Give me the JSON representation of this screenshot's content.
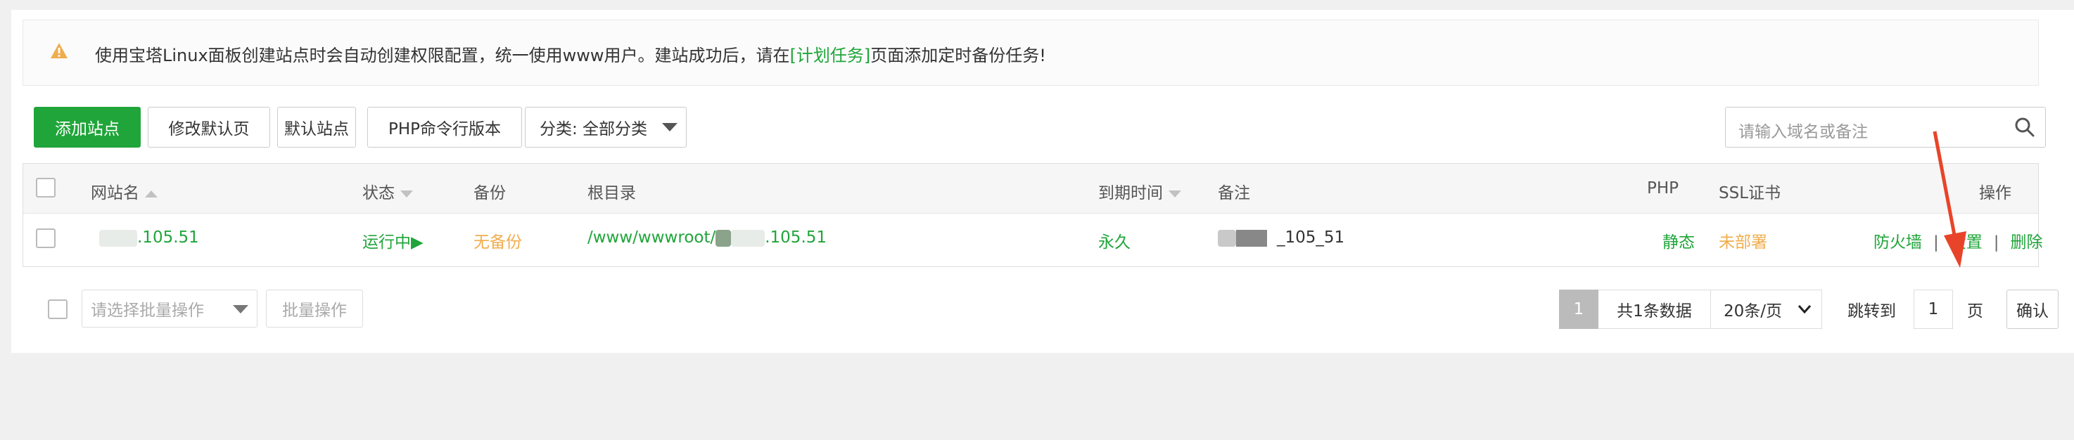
{
  "notice": {
    "before": "使用宝塔Linux面板创建站点时会自动创建权限配置，统一使用www用户。建站成功后，请在",
    "link": "[计划任务]",
    "after": "页面添加定时备份任务!",
    "icon": "warning-icon"
  },
  "toolbar": {
    "add_site": "添加站点",
    "modify_default_page": "修改默认页",
    "default_site": "默认站点",
    "php_cli_version": "PHP命令行版本",
    "category_select": "分类: 全部分类"
  },
  "search": {
    "placeholder": "请输入域名或备注",
    "icon": "search-icon"
  },
  "table": {
    "headers": {
      "site_name": "网站名",
      "status": "状态",
      "backup": "备份",
      "root": "根目录",
      "expire": "到期时间",
      "remark": "备注",
      "php": "PHP",
      "ssl": "SSL证书",
      "actions": "操作"
    },
    "rows": [
      {
        "site_name": ".105.51",
        "status": "运行中▶",
        "backup": "无备份",
        "root_prefix": "/www/wwwroot/",
        "root_suffix": ".105.51",
        "expire": "永久",
        "remark": "_105_51",
        "php": "静态",
        "ssl": "未部署",
        "actions": {
          "firewall": "防火墙",
          "settings": "设置",
          "delete": "删除",
          "separator": "|"
        }
      }
    ]
  },
  "footer": {
    "batch_select_placeholder": "请选择批量操作",
    "batch_button": "批量操作",
    "current_page": "1",
    "total": "共1条数据",
    "page_size": "20条/页",
    "jump_label": "跳转到",
    "jump_value": "1",
    "page_unit": "页",
    "confirm": "确认"
  },
  "colors": {
    "primary": "#20a53a",
    "warning": "#f0ad4e",
    "arrow": "#e8442a"
  }
}
